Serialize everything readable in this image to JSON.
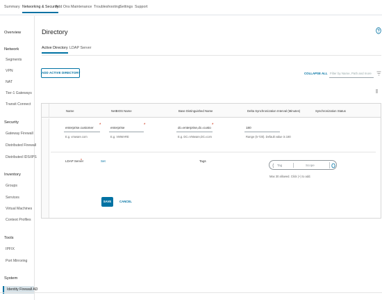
{
  "topnav": {
    "tabs": [
      {
        "label": "Summary"
      },
      {
        "label": "Networking & Security"
      },
      {
        "label": "Add Ons"
      },
      {
        "label": "Maintenance"
      },
      {
        "label": "Troubleshooting"
      },
      {
        "label": "Settings"
      },
      {
        "label": "Support"
      }
    ],
    "active_index": 1
  },
  "sidebar": {
    "overview": "Overview",
    "network": {
      "title": "Network",
      "items": [
        "Segments",
        "VPN",
        "NAT",
        "Tier-1 Gateways",
        "Transit Connect"
      ]
    },
    "security": {
      "title": "Security",
      "items": [
        "Gateway Firewall",
        "Distributed Firewall",
        "Distributed IDS/IPS"
      ]
    },
    "inventory": {
      "title": "Inventory",
      "items": [
        "Groups",
        "Services",
        "Virtual Machines",
        "Context Profiles"
      ]
    },
    "tools": {
      "title": "Tools",
      "items": [
        "IPFIX",
        "Port Mirroring"
      ]
    },
    "system": {
      "title": "System",
      "items": [
        "Identity Firewall AD"
      ]
    },
    "selected": "Identity Firewall AD"
  },
  "main": {
    "title": "Directory",
    "subtabs": [
      {
        "label": "Active Directory"
      },
      {
        "label": "LDAP Server"
      }
    ],
    "active_subtab": 0,
    "add_button": "ADD ACTIVE DIRECTORY",
    "collapse_all": "COLLAPSE ALL",
    "filter_placeholder": "Filter by Name, Path and more"
  },
  "grid": {
    "columns": [
      "Name",
      "NetBIOS Name",
      "Base Distinguished Name",
      "Delta Synchronization Interval (Minutes)",
      "Synchronization Status"
    ],
    "row": {
      "name": {
        "value": "enterprise.customer",
        "hint": "E.g. vmware.com"
      },
      "netbios": {
        "value": "enterprise",
        "hint": "E.g. VMWARE"
      },
      "base_dn": {
        "value": "dc=enterprise,dc=custo",
        "hint": "E.g. DC=VMware,DC=com"
      },
      "delta_sync": {
        "value": "180",
        "hint": "Range (5-720). Default value is 180"
      },
      "ldap_server_label": "LDAP Server",
      "ldap_server_action": "Set",
      "tags_label": "Tags",
      "tag_placeholder": "Tag",
      "scope_placeholder": "Scope",
      "tags_hint": "Max 30 allowed. Click (+) to add.",
      "save": "SAVE",
      "cancel": "CANCEL"
    }
  },
  "colors": {
    "accent": "#0072a3",
    "required": "#c92100",
    "selected_bg": "#d8e3e9"
  }
}
